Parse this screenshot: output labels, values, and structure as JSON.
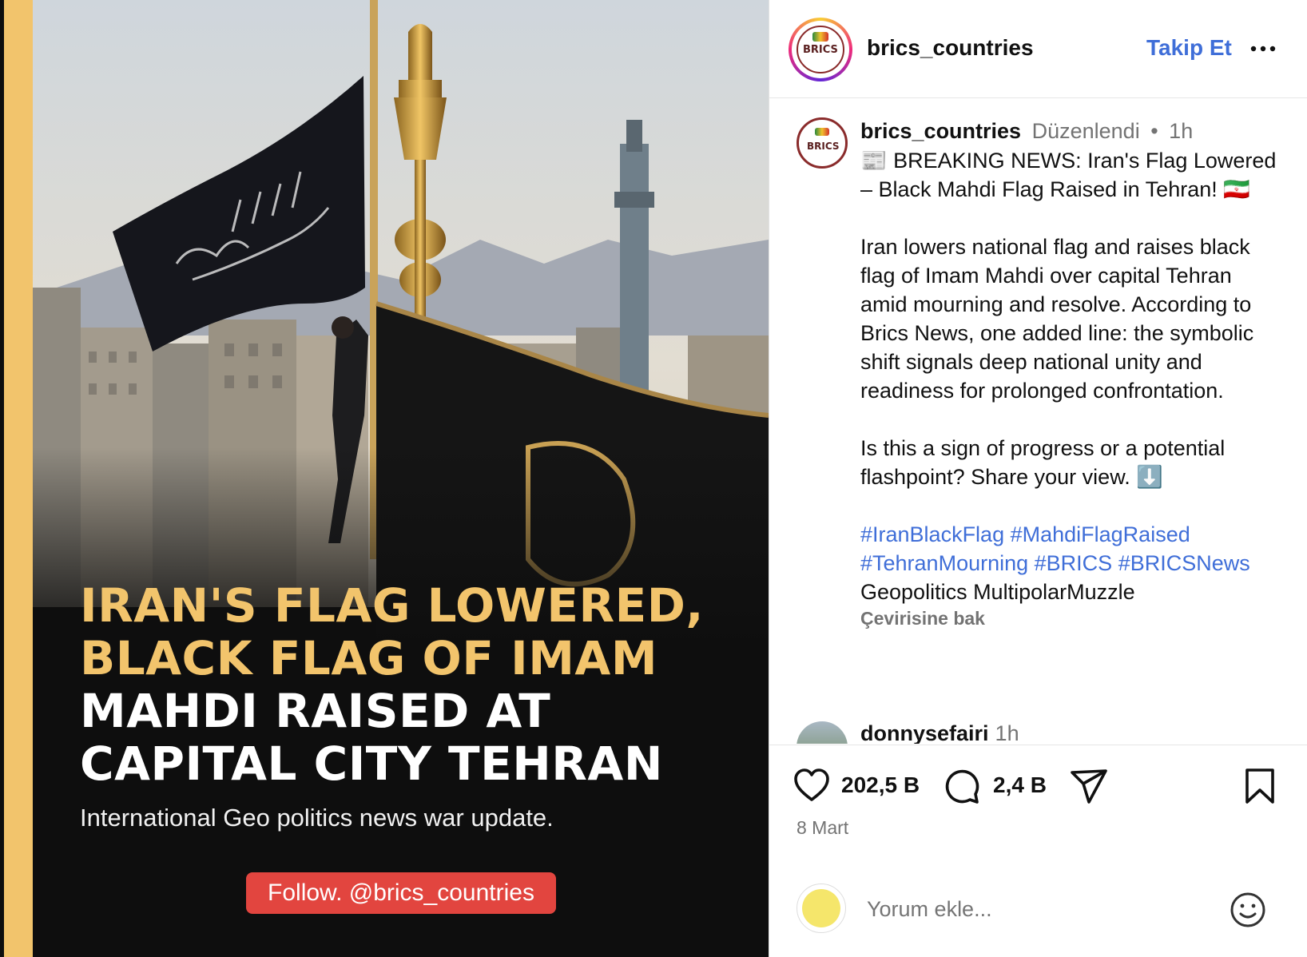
{
  "media": {
    "headline_lines": [
      {
        "text": "IRAN'S FLAG LOWERED,",
        "color": "gold"
      },
      {
        "text": "BLACK FLAG OF IMAM",
        "color": "gold"
      },
      {
        "text": "MAHDI RAISED AT",
        "color": "white"
      },
      {
        "text": "CAPITAL CITY TEHRAN",
        "color": "white"
      }
    ],
    "subline": "International Geo politics news war update.",
    "follow_pill": "Follow. @brics_countries"
  },
  "header": {
    "username": "brics_countries",
    "follow_label": "Takip Et",
    "avatar_text": "BRICS"
  },
  "caption": {
    "username": "brics_countries",
    "edited": "Düzenlendi",
    "dot": "•",
    "time": "1h",
    "avatar_text": "BRICS",
    "line1": "📰 BREAKING NEWS: Iran's Flag Lowered – Black Mahdi Flag Raised in Tehran! 🇮🇷",
    "para2": "Iran lowers national flag and raises black flag of Imam Mahdi over capital Tehran amid mourning and resolve. According to Brics News, one added line: the symbolic shift signals deep national unity and readiness for prolonged confrontation.",
    "para3": "Is this a sign of progress or a potential flashpoint? Share your view. ⬇️",
    "hashtags": [
      "#IranBlackFlag",
      "#MahdiFlagRaised",
      "#TehranMourning",
      "#BRICS",
      "#BRICSNews"
    ],
    "tail": "Geopolitics MultipolarMuzzle",
    "see_translation": "Çevirisine bak"
  },
  "comment_preview": {
    "username": "donnysefairi",
    "time": "1h"
  },
  "actions": {
    "likes": "202,5 B",
    "comments": "2,4 B",
    "date": "8 Mart"
  },
  "add_comment": {
    "placeholder": "Yorum ekle..."
  },
  "colors": {
    "accent_blue": "#3f6ed8",
    "gold": "#f2c46c",
    "pill_red": "#e2453f",
    "brand_maroon": "#8a2b2b"
  },
  "icons": [
    "more-icon",
    "heart-icon",
    "comment-icon",
    "share-icon",
    "bookmark-icon",
    "emoji-icon"
  ]
}
